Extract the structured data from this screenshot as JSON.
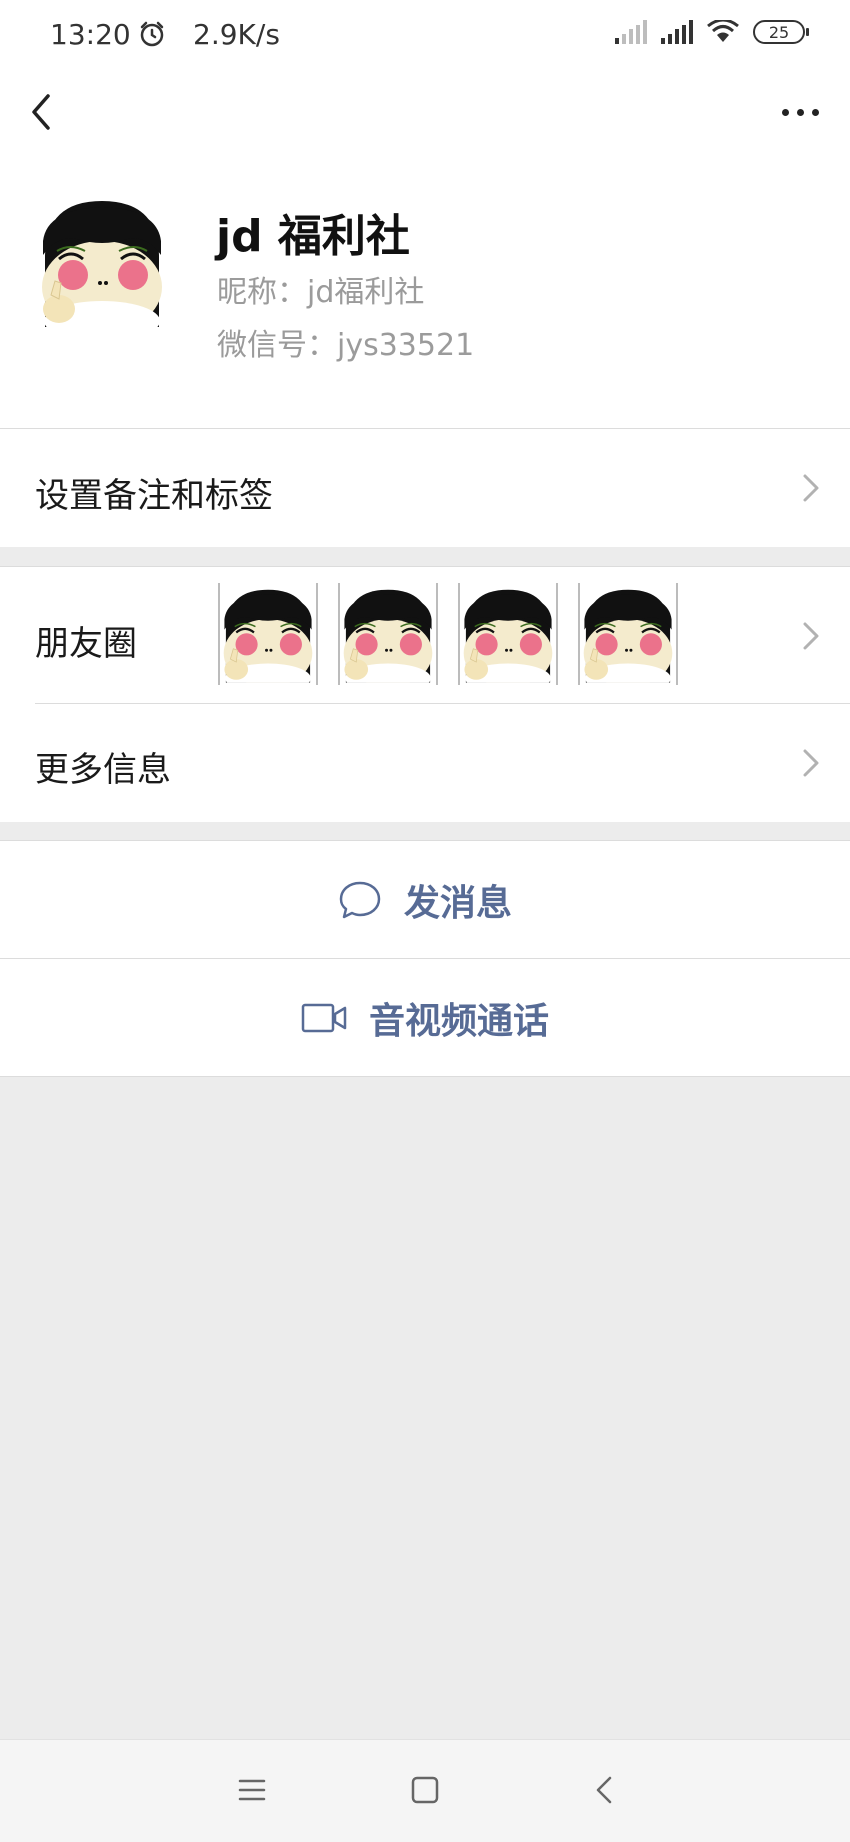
{
  "status_bar": {
    "time": "13:20",
    "net_speed": "2.9K/s",
    "battery": "25",
    "icons": [
      "alarm-icon",
      "signal-weak-icon",
      "signal-strong-icon",
      "wifi-icon",
      "battery-icon"
    ]
  },
  "nav": {
    "icons": [
      "back-icon",
      "more-icon"
    ]
  },
  "profile": {
    "name": "jd 福利社",
    "nickname": "昵称：jd福利社",
    "wechat_id": "微信号：jys33521"
  },
  "rows": {
    "remark": "设置备注和标签",
    "moments": "朋友圈",
    "more_info": "更多信息"
  },
  "actions": {
    "message": "发消息",
    "call": "音视频通话"
  },
  "colors": {
    "link": "#576b95",
    "background": "#ececec",
    "meta_text": "#9b9b9b"
  },
  "system_nav": {
    "icons": [
      "menu-icon",
      "home-icon",
      "back-nav-icon"
    ]
  }
}
